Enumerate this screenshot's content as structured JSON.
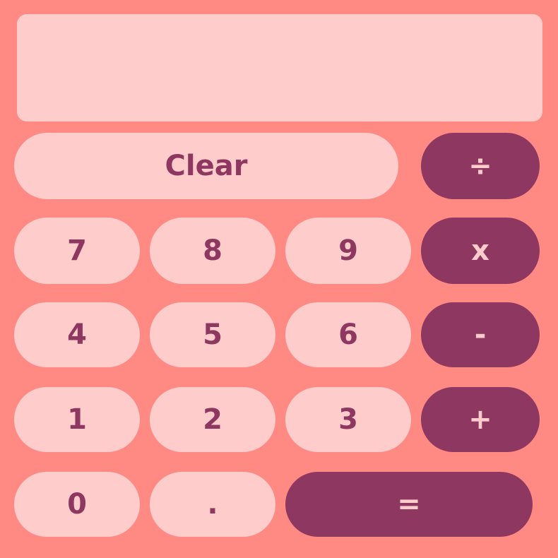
{
  "display": {
    "value": ""
  },
  "buttons": {
    "clear": "Clear",
    "divide": "÷",
    "multiply": "x",
    "subtract": "-",
    "add": "+",
    "equals": "=",
    "seven": "7",
    "eight": "8",
    "nine": "9",
    "four": "4",
    "five": "5",
    "six": "6",
    "one": "1",
    "two": "2",
    "three": "3",
    "zero": "0",
    "decimal": "."
  },
  "colors": {
    "background": "#FF8A84",
    "key_light": "#FFCCCC",
    "key_dark": "#8E3760"
  }
}
